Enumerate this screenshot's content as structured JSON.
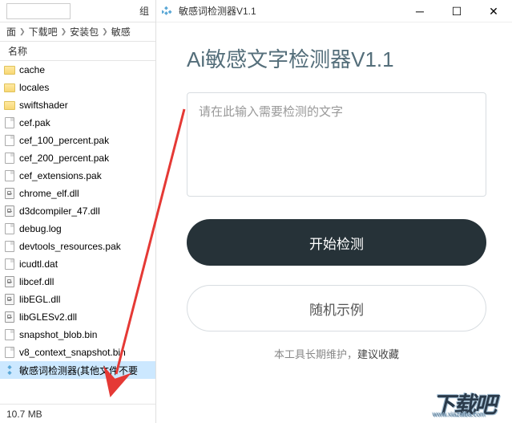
{
  "explorer": {
    "group_label": "组",
    "breadcrumb": [
      "面",
      "下载吧",
      "安装包",
      "敏感"
    ],
    "column_header": "名称",
    "files": [
      {
        "name": "cache",
        "type": "folder"
      },
      {
        "name": "locales",
        "type": "folder"
      },
      {
        "name": "swiftshader",
        "type": "folder"
      },
      {
        "name": "cef.pak",
        "type": "doc"
      },
      {
        "name": "cef_100_percent.pak",
        "type": "doc"
      },
      {
        "name": "cef_200_percent.pak",
        "type": "doc"
      },
      {
        "name": "cef_extensions.pak",
        "type": "doc"
      },
      {
        "name": "chrome_elf.dll",
        "type": "dll"
      },
      {
        "name": "d3dcompiler_47.dll",
        "type": "dll"
      },
      {
        "name": "debug.log",
        "type": "doc"
      },
      {
        "name": "devtools_resources.pak",
        "type": "doc"
      },
      {
        "name": "icudtl.dat",
        "type": "doc"
      },
      {
        "name": "libcef.dll",
        "type": "dll"
      },
      {
        "name": "libEGL.dll",
        "type": "dll"
      },
      {
        "name": "libGLESv2.dll",
        "type": "dll"
      },
      {
        "name": "snapshot_blob.bin",
        "type": "doc"
      },
      {
        "name": "v8_context_snapshot.bin",
        "type": "doc"
      },
      {
        "name": "敏感词检测器(其他文件不要",
        "type": "exe",
        "selected": true
      }
    ],
    "status_size": "10.7 MB"
  },
  "app": {
    "window_title": "敏感词检测器V1.1",
    "heading": "Ai敏感文字检测器V1.1",
    "textarea_placeholder": "请在此输入需要检测的文字",
    "btn_primary": "开始检测",
    "btn_secondary": "随机示例",
    "footer_a": "本工具长期维护，",
    "footer_b": "建议收藏"
  },
  "watermark": {
    "text": "下载吧",
    "url": "www.xiazaiba.com"
  }
}
